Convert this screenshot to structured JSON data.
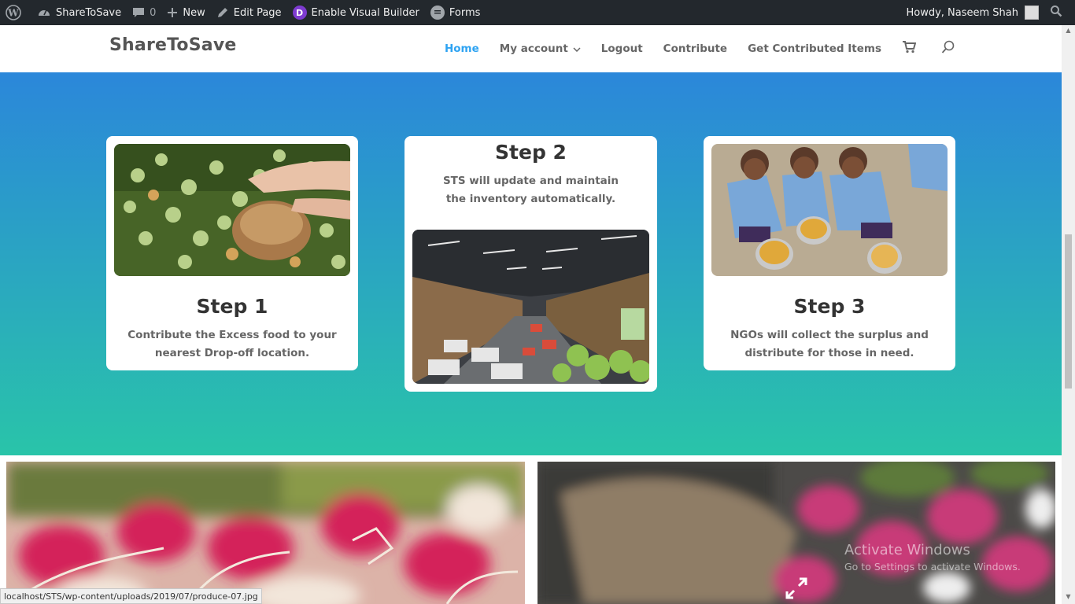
{
  "admin_bar": {
    "wp_logo_icon": "wordpress-icon",
    "site_name": "ShareToSave",
    "comments_count": "0",
    "new_label": "New",
    "edit_page_label": "Edit Page",
    "divi_letter": "D",
    "visual_builder_label": "Enable Visual Builder",
    "forms_label": "Forms",
    "howdy_label": "Howdy, Naseem Shah"
  },
  "header": {
    "logo": "ShareToSave",
    "nav": [
      {
        "label": "Home",
        "active": true
      },
      {
        "label": "My account",
        "dropdown": true
      },
      {
        "label": "Logout"
      },
      {
        "label": "Contribute"
      },
      {
        "label": "Get Contributed Items"
      }
    ]
  },
  "steps": [
    {
      "title": "Step 1",
      "text": "Contribute the Excess food to your nearest Drop-off location."
    },
    {
      "title": "Step 2",
      "text": "STS will update and maintain the inventory automatically."
    },
    {
      "title": "Step 3",
      "text": "NGOs will collect the surplus and distribute for those in need."
    }
  ],
  "watermark": {
    "line1": "Activate Windows",
    "line2": "Go to Settings to activate Windows."
  },
  "status_url": "localhost/STS/wp-content/uploads/2019/07/produce-07.jpg",
  "colors": {
    "admin_bar": "#23282d",
    "accent": "#2ea3f2",
    "hero_top": "#2b87da",
    "hero_bottom": "#29c4a9"
  }
}
